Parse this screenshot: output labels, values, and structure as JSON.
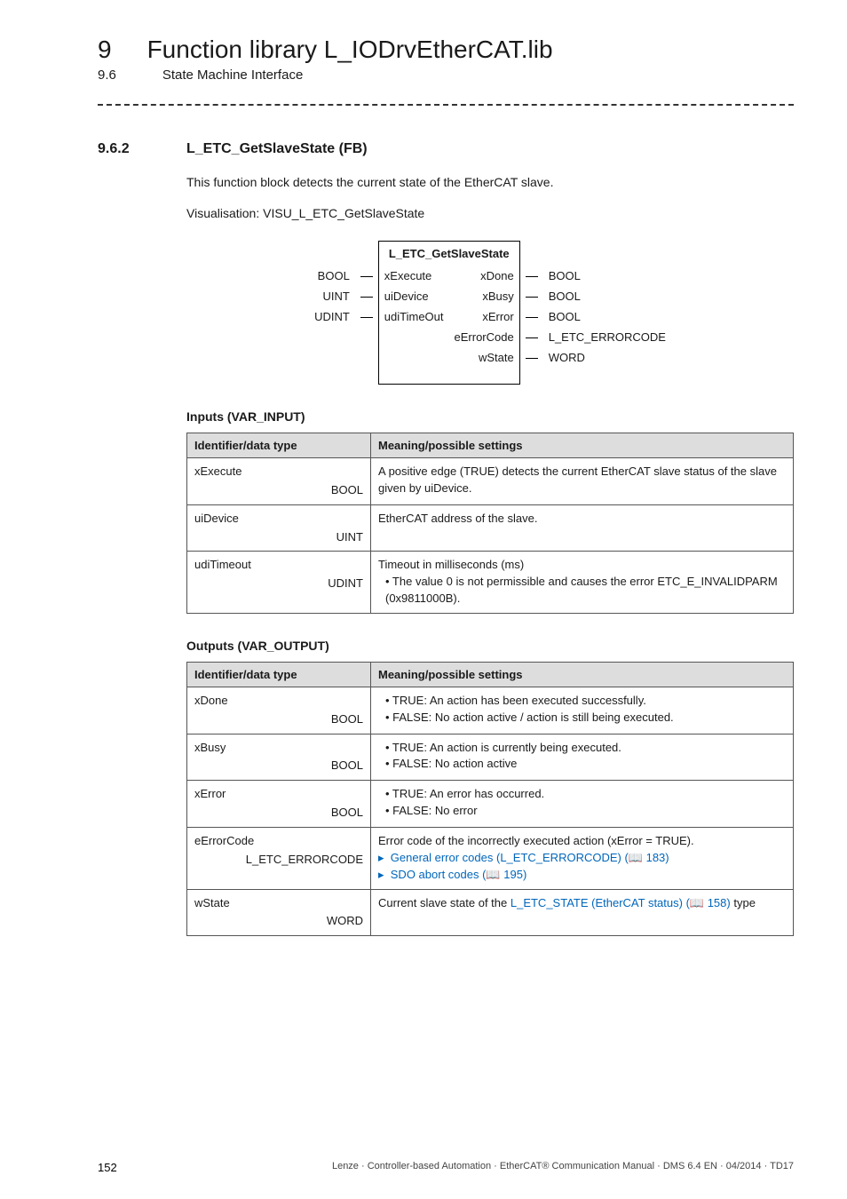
{
  "header": {
    "chapter_num": "9",
    "chapter_title": "Function library L_IODrvEtherCAT.lib",
    "section_num": "9.6",
    "section_title": "State Machine Interface"
  },
  "section": {
    "num": "9.6.2",
    "title": "L_ETC_GetSlaveState (FB)",
    "para1": "This function block detects the current state of the EtherCAT slave.",
    "para2": "Visualisation: VISU_L_ETC_GetSlaveState"
  },
  "block": {
    "name": "L_ETC_GetSlaveState",
    "inputs": [
      {
        "type": "BOOL",
        "name": "xExecute"
      },
      {
        "type": "UINT",
        "name": "uiDevice"
      },
      {
        "type": "UDINT",
        "name": "udiTimeOut"
      }
    ],
    "outputs": [
      {
        "name": "xDone",
        "type": "BOOL"
      },
      {
        "name": "xBusy",
        "type": "BOOL"
      },
      {
        "name": "xError",
        "type": "BOOL"
      },
      {
        "name": "eErrorCode",
        "type": "L_ETC_ERRORCODE"
      },
      {
        "name": "wState",
        "type": "WORD"
      }
    ]
  },
  "tables": {
    "inputs_title": "Inputs (VAR_INPUT)",
    "outputs_title": "Outputs (VAR_OUTPUT)",
    "col_ident": "Identifier/data type",
    "col_mean": "Meaning/possible settings",
    "in_rows": [
      {
        "name": "xExecute",
        "type": "BOOL",
        "mean_lines": [
          "A positive edge (TRUE) detects the current EtherCAT slave status of the slave given by uiDevice."
        ]
      },
      {
        "name": "uiDevice",
        "type": "UINT",
        "mean_lines": [
          "EtherCAT address of the slave."
        ]
      },
      {
        "name": "udiTimeout",
        "type": "UDINT",
        "mean_lines": [
          "Timeout in milliseconds (ms)",
          "• The value 0 is not permissible and causes the error ETC_E_INVALIDPARM (0x9811000B)."
        ]
      }
    ],
    "out_rows": [
      {
        "name": "xDone",
        "type": "BOOL",
        "mean_lines": [
          "• TRUE: An action has been executed successfully.",
          "• FALSE: No action active / action is still being executed."
        ]
      },
      {
        "name": "xBusy",
        "type": "BOOL",
        "mean_lines": [
          "• TRUE: An action is currently being executed.",
          "• FALSE: No action active"
        ]
      },
      {
        "name": "xError",
        "type": "BOOL",
        "mean_lines": [
          "• TRUE: An error has occurred.",
          "• FALSE: No error"
        ]
      },
      {
        "name": "eErrorCode",
        "type": "L_ETC_ERRORCODE",
        "mean_plain": "Error code of the incorrectly executed action (xError = TRUE).",
        "mean_links": [
          {
            "text": "General error codes (L_ETC_ERRORCODE)",
            "page": "183"
          },
          {
            "text": "SDO abort codes",
            "page": "195"
          }
        ]
      },
      {
        "name": "wState",
        "type": "WORD",
        "mean_prefix": "Current slave state of the ",
        "mean_link_text": "L_ETC_STATE (EtherCAT status)",
        "mean_link_page": "158",
        "mean_suffix": " type"
      }
    ]
  },
  "footer": {
    "page": "152",
    "line": "Lenze · Controller-based Automation · EtherCAT® Communication Manual · DMS 6.4 EN · 04/2014 · TD17"
  }
}
